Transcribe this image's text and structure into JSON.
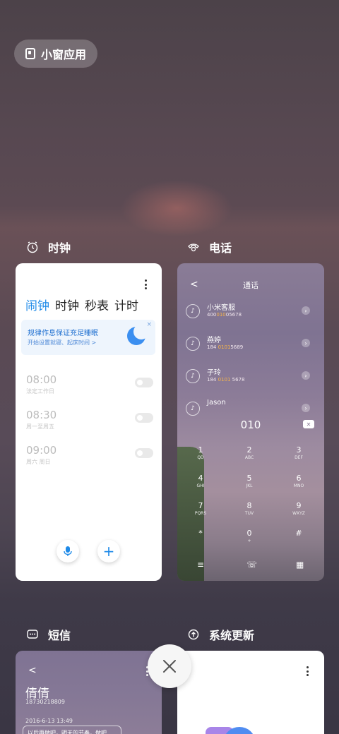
{
  "mini_window": {
    "label": "小窗应用"
  },
  "apps": {
    "clock": {
      "title": "时钟",
      "tabs": [
        "闹钟",
        "时钟",
        "秒表",
        "计时"
      ],
      "banner": {
        "title": "规律作息保证充足睡眠",
        "subtitle": "开始设置就寝、起床时间 >",
        "close": "×"
      },
      "alarms": [
        {
          "time": "08:00",
          "repeat": "法定工作日"
        },
        {
          "time": "08:30",
          "repeat": "周一至周五"
        },
        {
          "time": "09:00",
          "repeat": "周六 周日"
        }
      ],
      "fab_add": "+"
    },
    "phone": {
      "title": "电话",
      "screen_title": "通话",
      "back": "<",
      "contacts": [
        {
          "name": "小米客服",
          "num_pre": "400",
          "num_hit": "010",
          "num_post": "05678"
        },
        {
          "name": "燕婷",
          "num_pre": "184 ",
          "num_hit": "0101",
          "num_post": "5689"
        },
        {
          "name": "子玲",
          "num_pre": "184 ",
          "num_hit": "0101",
          "num_post": " 5678"
        },
        {
          "name": "Jason",
          "num_pre": "",
          "num_hit": "",
          "num_post": ""
        }
      ],
      "dialed": "010",
      "keys": [
        {
          "d": "1",
          "l": "QD"
        },
        {
          "d": "2",
          "l": "ABC"
        },
        {
          "d": "3",
          "l": "DEF"
        },
        {
          "d": "4",
          "l": "GHI"
        },
        {
          "d": "5",
          "l": "JKL"
        },
        {
          "d": "6",
          "l": "MNO"
        },
        {
          "d": "7",
          "l": "PQRS"
        },
        {
          "d": "8",
          "l": "TUV"
        },
        {
          "d": "9",
          "l": "WXYZ"
        },
        {
          "d": "*",
          "l": ""
        },
        {
          "d": "0",
          "l": "+"
        },
        {
          "d": "#",
          "l": ""
        }
      ]
    },
    "sms": {
      "title": "短信",
      "contact": "倩倩",
      "number": "18730218809",
      "date": "2016-6-13 13:49",
      "preview": "以后再做吧，明天的节奏，做吧"
    },
    "update": {
      "title": "系统更新"
    }
  },
  "close_label": "×"
}
